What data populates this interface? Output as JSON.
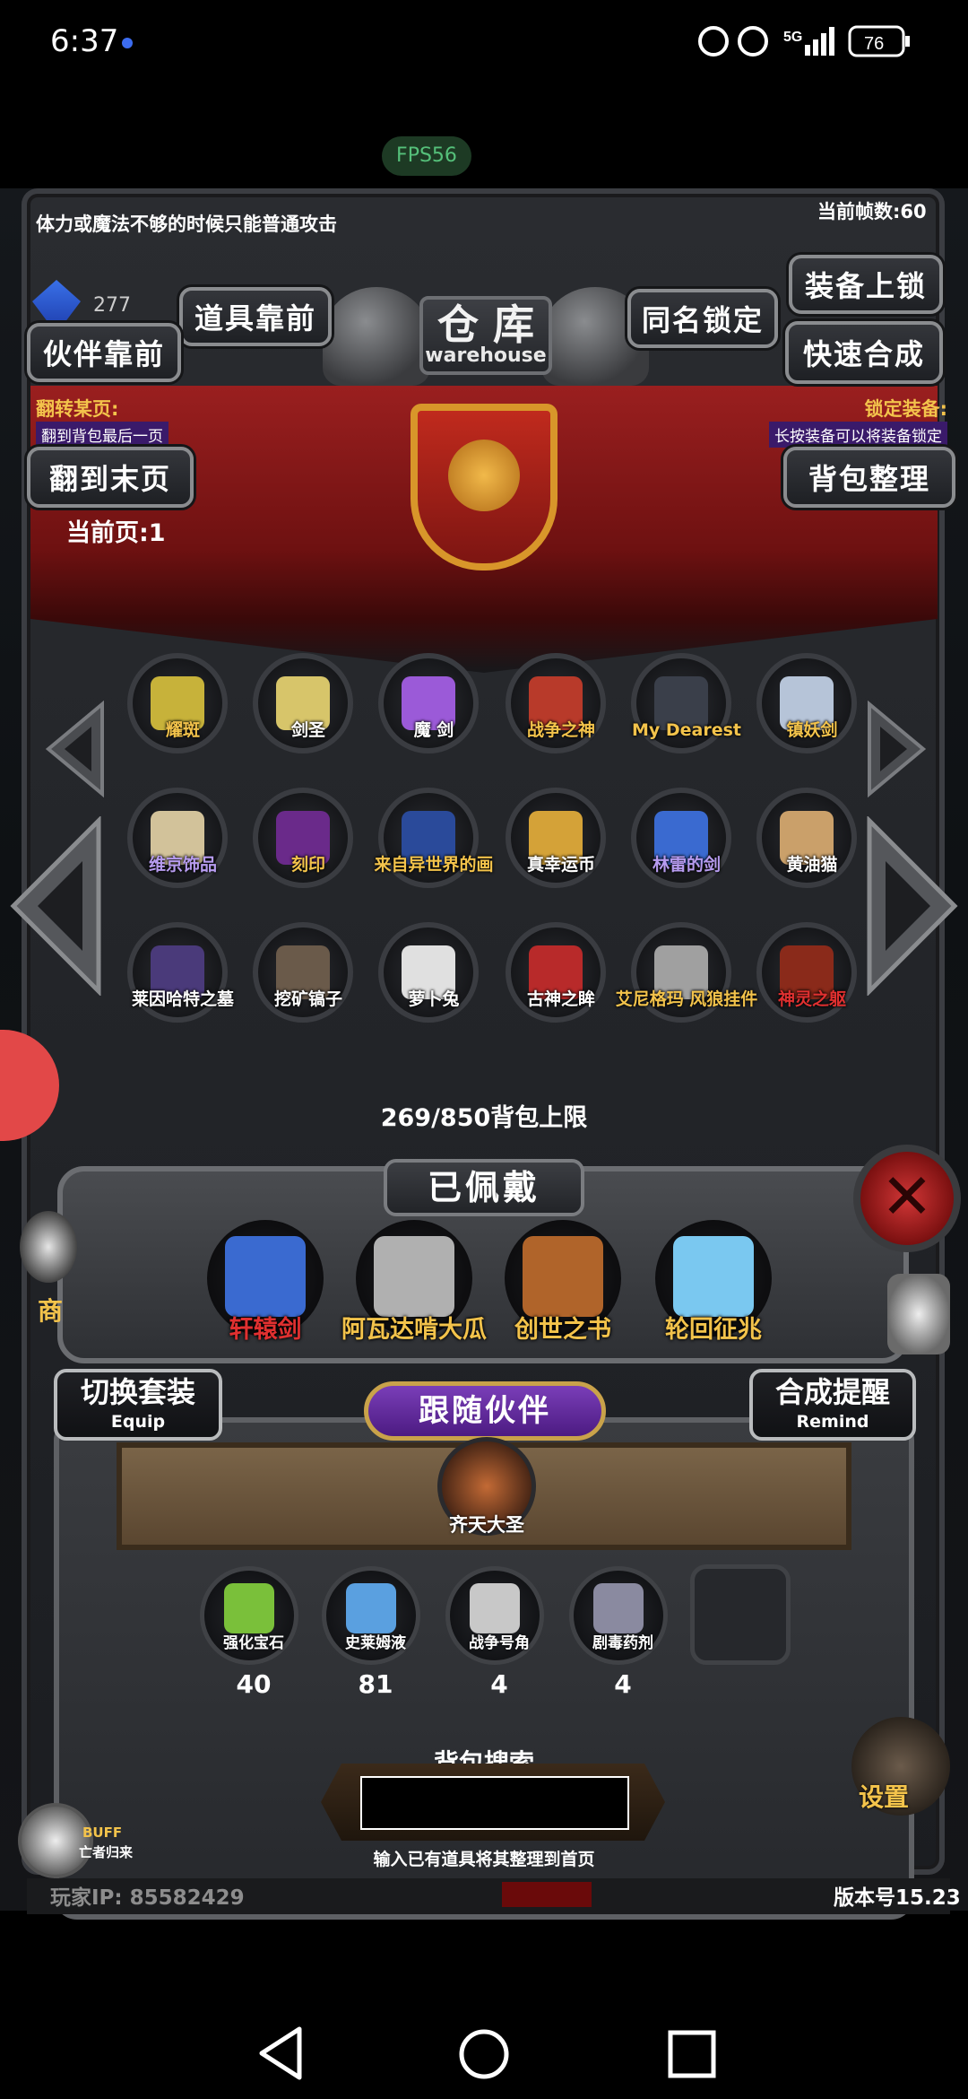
{
  "status_bar": {
    "time": "6:37",
    "network": "5G",
    "battery": "76"
  },
  "fps_pill": "FPS56",
  "game": {
    "tip": "体力或魔法不够的时候只能普通攻击",
    "current_fps": "当前帧数:60",
    "gem_count": "277",
    "title_cn": "仓 库",
    "title_en": "warehouse",
    "buttons": {
      "items_front": "道具靠前",
      "partner_front": "伙伴靠前",
      "same_name_lock": "同名锁定",
      "equip_lock": "装备上锁",
      "quick_merge": "快速合成",
      "goto_last": "翻到末页",
      "sort_bag": "背包整理"
    },
    "hints": {
      "flip_title": "翻转某页:",
      "flip_sub": "翻到背包最后一页",
      "lock_title": "锁定装备:",
      "lock_sub": "长按装备可以将装备锁定"
    },
    "current_page": "当前页:1",
    "grid_items": [
      {
        "label": "耀斑",
        "color": "#f3c34b",
        "art": "#c7b23a"
      },
      {
        "label": "剑圣",
        "color": "#ffffff",
        "art": "#d7c56a"
      },
      {
        "label": "魔 剑",
        "color": "#ffffff",
        "art": "#9b5ad8"
      },
      {
        "label": "战争之神",
        "color": "#f3c34b",
        "art": "#b83a2a"
      },
      {
        "label": "My Dearest",
        "color": "#f3c34b",
        "art": "#3a3f4a"
      },
      {
        "label": "镇妖剑",
        "color": "#f3c34b",
        "art": "#b6c4d8"
      },
      {
        "label": "维京饰品",
        "color": "#b79cf0",
        "art": "#d2c29a"
      },
      {
        "label": "刻印",
        "color": "#f3c34b",
        "art": "#6a2a8a"
      },
      {
        "label": "来自异世界的画",
        "color": "#f3c34b",
        "art": "#2a4a9a"
      },
      {
        "label": "真幸运币",
        "color": "#ffffff",
        "art": "#d4a238"
      },
      {
        "label": "林雷的剑",
        "color": "#b79cf0",
        "art": "#3a6ad0"
      },
      {
        "label": "黄油猫",
        "color": "#ffffff",
        "art": "#caa06a"
      },
      {
        "label": "莱因哈特之墓",
        "color": "#ffffff",
        "art": "#4a3a7a"
      },
      {
        "label": "挖矿镐子",
        "color": "#ffffff",
        "art": "#6a5a4a"
      },
      {
        "label": "萝卜兔",
        "color": "#ffffff",
        "art": "#e0e0e0"
      },
      {
        "label": "古神之眸",
        "color": "#ffffff",
        "art": "#b82a2a"
      },
      {
        "label": "艾尼格玛 风狼挂件",
        "color": "#f3c34b",
        "art": "#a0a0a0"
      },
      {
        "label": "神灵之躯",
        "color": "#e03030",
        "art": "#8a2a1a"
      }
    ],
    "capacity": "269/850背包上限",
    "equipped_title": "已佩戴",
    "equipped": [
      {
        "label": "轩辕剑",
        "color": "#e03030",
        "art": "#3a6ad0"
      },
      {
        "label": "阿瓦达啃大瓜",
        "color": "#f3c34b",
        "art": "#b0b0b0"
      },
      {
        "label": "创世之书",
        "color": "#f3c34b",
        "art": "#b0642a"
      },
      {
        "label": "轮回征兆",
        "color": "#f3c34b",
        "art": "#7ac8f0"
      }
    ],
    "switch_set": {
      "cn": "切换套装",
      "en": "Equip"
    },
    "merge_remind": {
      "cn": "合成提醒",
      "en": "Remind"
    },
    "follow_partner": "跟随伙伴",
    "partner_name": "齐天大圣",
    "materials": [
      {
        "label": "强化宝石",
        "count": "40",
        "art": "#7ac03a"
      },
      {
        "label": "史莱姆液",
        "count": "81",
        "art": "#5aa0e0"
      },
      {
        "label": "战争号角",
        "count": "4",
        "art": "#c8c8c8"
      },
      {
        "label": "剧毒药剂",
        "count": "4",
        "art": "#8a8aa0"
      }
    ],
    "search_title": "背包搜索",
    "search_value": "",
    "search_hint": "输入已有道具将其整理到首页",
    "buff_label": "BUFF",
    "buff_sub": "亡者归来",
    "player_ip": "玩家IP: 85582429",
    "version": "版本号15.23",
    "settings": "设置",
    "side_shop": "商"
  },
  "colors": {
    "gold": "#f3c34b",
    "banner_red": "#9a1f1f",
    "purple": "#4c1b82"
  }
}
